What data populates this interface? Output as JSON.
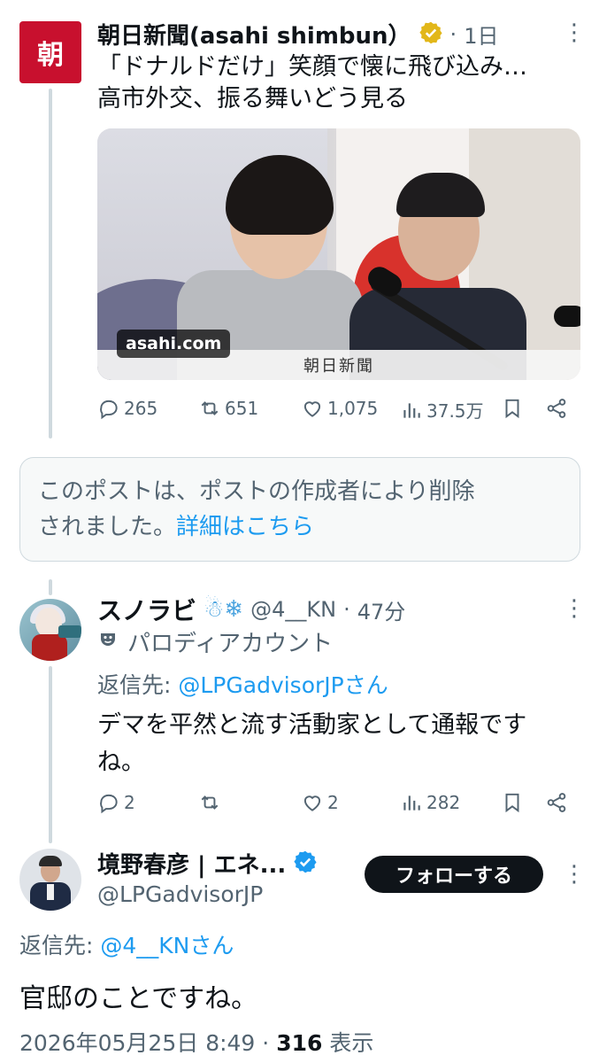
{
  "post1": {
    "logo_char": "朝",
    "name": "朝日新聞(asahi shimbun）",
    "verified_color": "#e2b719",
    "sep": "·",
    "time": "1日",
    "more": "⋮",
    "text_line1": "「ドナルドだけ」笑顔で懐に飛び込み…",
    "text_line2": "高市外交、振る舞いどう見る",
    "media": {
      "source": "asahi.com",
      "caption": "朝日新聞"
    },
    "stats": {
      "replies": "265",
      "reposts": "651",
      "likes": "1,075",
      "views": "37.5万"
    }
  },
  "deleted_notice": {
    "line1": "このポストは、ポストの作成者により削除",
    "line2_prefix": "されました。",
    "link": "詳細はこちら"
  },
  "reply1": {
    "name": "スノラビ",
    "emoji": "☃❄",
    "handle": "@4__KN",
    "sep": "·",
    "time": "47分",
    "more": "⋮",
    "parody_label": "パロディアカウント",
    "reply_to_prefix": "返信先: ",
    "reply_to_handle": "@LPGadvisorJPさん",
    "text_line1": "デマを平然と流す活動家として通報です",
    "text_line2": "ね。",
    "stats": {
      "replies": "2",
      "reposts": "",
      "likes": "2",
      "views": "282"
    }
  },
  "reply2": {
    "name": "境野春彦 | エネ...",
    "verified_color": "#1d9bf0",
    "handle": "@LPGadvisorJP",
    "follow_label": "フォローする",
    "more": "⋮",
    "reply_to_prefix": "返信先: ",
    "reply_to_handle": "@4__KNさん",
    "text": "官邸のことですね。",
    "timestamp": "2026年05月25日 8:49",
    "sep": "·",
    "view_count": "316",
    "view_label": "表示"
  },
  "colors": {
    "text": "#0f1419",
    "secondary": "#536471",
    "link": "#1d9bf0",
    "line": "#cfd9de"
  }
}
